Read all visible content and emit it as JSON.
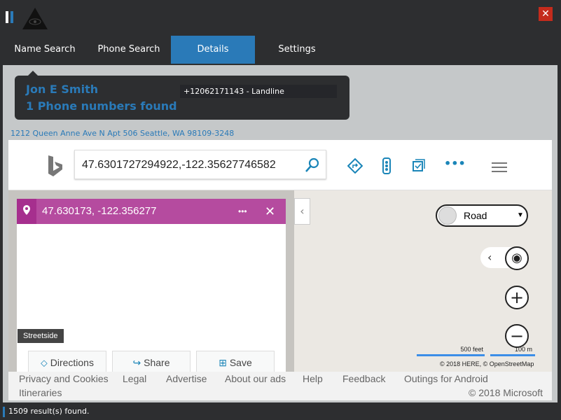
{
  "window": {
    "close_label": "✕"
  },
  "tabs": [
    {
      "label": "Name Search"
    },
    {
      "label": "Phone Search"
    },
    {
      "label": "Details",
      "active": true
    },
    {
      "label": "Settings"
    }
  ],
  "details": {
    "name": "Jon E Smith",
    "phone_count": "1 Phone numbers found",
    "phones": [
      "+12062171143 - Landline"
    ],
    "address": "1212 Queen Anne Ave N Apt 506 Seattle, WA 98109-3248"
  },
  "map": {
    "search_value": "47.6301727294922,-122.35627746582",
    "infobox_title": "47.630173, -122.356277",
    "streetside_label": "Streetside",
    "buttons": {
      "directions": "Directions",
      "share": "Share",
      "save": "Save"
    },
    "map_style": "Road",
    "scale_feet": "500 feet",
    "scale_m": "100 m",
    "attribution": "© 2018 HERE, © OpenStreetMap",
    "footer_links": [
      "Privacy and Cookies",
      "Legal",
      "Advertise",
      "About our ads",
      "Help",
      "Feedback",
      "Outings for Android",
      "Itineraries"
    ],
    "copyright": "© 2018 Microsoft",
    "accent": "#b54b9f"
  },
  "status": {
    "text": "1509 result(s) found."
  },
  "colors": {
    "brand_blue": "#2a7ab8",
    "dark": "#2d2e30"
  }
}
